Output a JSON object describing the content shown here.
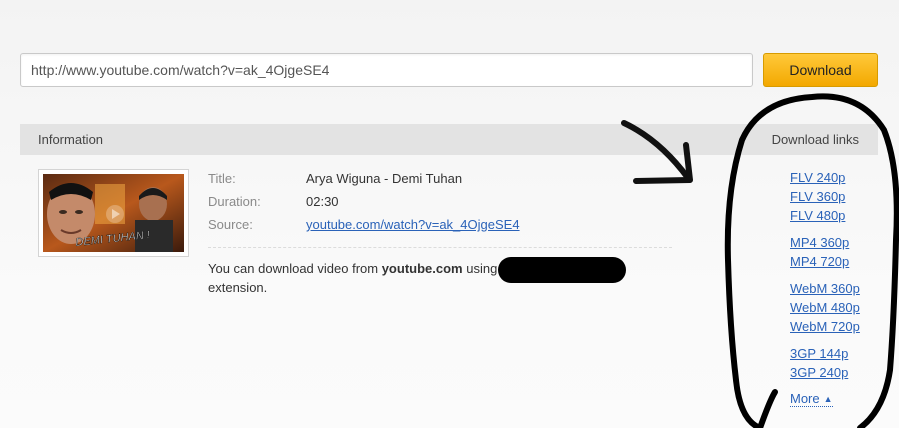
{
  "search": {
    "url_value": "http://www.youtube.com/watch?v=ak_4OjgeSE4",
    "button_label": "Download"
  },
  "info_panel": {
    "header": "Information",
    "links_header": "Download links",
    "thumbnail_caption": "DEMI TUHAN !",
    "fields": {
      "title_label": "Title:",
      "title_value": "Arya Wiguna - Demi Tuhan",
      "duration_label": "Duration:",
      "duration_value": "02:30",
      "source_label": "Source:",
      "source_value": "youtube.com/watch?v=ak_4OjgeSE4"
    },
    "note": {
      "prefix": "You can download video from ",
      "site": "youtube.com",
      "middle": " using",
      "suffix": "extension."
    }
  },
  "download_links": {
    "flv": [
      "FLV 240p",
      "FLV 360p",
      "FLV 480p"
    ],
    "mp4": [
      "MP4 360p",
      "MP4 720p"
    ],
    "webm": [
      "WebM 360p",
      "WebM 480p",
      "WebM 720p"
    ],
    "gp3": [
      "3GP 144p",
      "3GP 240p"
    ],
    "more": "More"
  },
  "icons": {
    "more_caret": "caret-up-icon",
    "arrow_annotation": "arrow-down-right-icon"
  },
  "colors": {
    "button": "#f3a800",
    "link": "#2a62b8",
    "header_bar": "#e3e3e3"
  }
}
